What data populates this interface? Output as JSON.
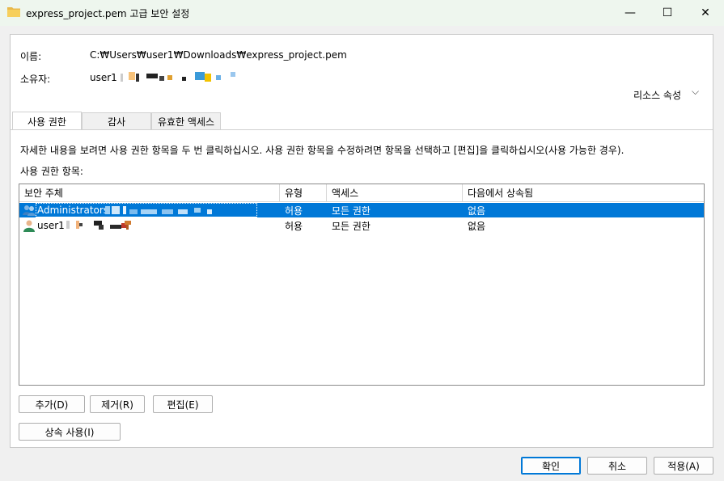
{
  "window": {
    "title": "express_project.pem 고급 보안 설정",
    "minimize_glyph": "—",
    "maximize_glyph": "☐",
    "close_glyph": "✕",
    "title_icon": "folder-icon"
  },
  "info": {
    "name_label": "이름:",
    "name_value": "C:₩Users₩user1₩Downloads₩express_project.pem",
    "owner_label": "소유자:",
    "owner_value": "user1",
    "resource_properties": "리소스 속성",
    "resource_chevron": "⌵"
  },
  "tabs": [
    {
      "label": "사용 권한"
    },
    {
      "label": "감사"
    },
    {
      "label": "유효한 액세스"
    }
  ],
  "description": "자세한 내용을 보려면 사용 권한 항목을 두 번 클릭하십시오. 사용 권한 항목을 수정하려면 항목을 선택하고 [편집]을 클릭하십시오(사용 가능한 경우).",
  "entries_label": "사용 권한 항목:",
  "table": {
    "headers": [
      "보안 주체",
      "유형",
      "액세스",
      "다음에서 상속됨"
    ],
    "rows": [
      {
        "principal": "Administrators",
        "type": "허용",
        "access": "모든 권한",
        "inherited": "없음",
        "icon": "group-users-icon",
        "selected": true
      },
      {
        "principal": "user1",
        "type": "허용",
        "access": "모든 권한",
        "inherited": "없음",
        "icon": "user-icon",
        "selected": false
      }
    ]
  },
  "buttons": {
    "add": "추가(D)",
    "remove": "제거(R)",
    "edit": "편집(E)",
    "enable_inheritance": "상속 사용(I)",
    "ok": "확인",
    "cancel": "취소",
    "apply": "적용(A)"
  },
  "colors": {
    "selection": "#0078d7",
    "titlebar": "#eef6ee"
  }
}
